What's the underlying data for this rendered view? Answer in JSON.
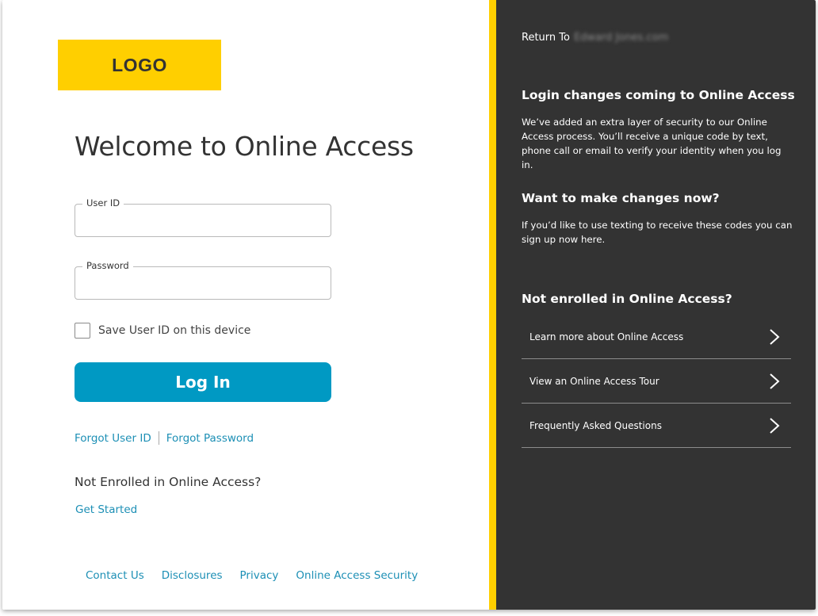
{
  "left": {
    "logo": "LOGO",
    "title": "Welcome to Online Access",
    "user_id_label": "User ID",
    "user_id_value": "",
    "password_label": "Password",
    "password_value": "",
    "save_user_label": "Save User ID on this device",
    "save_user_checked": false,
    "login_label": "Log In",
    "forgot_user": "Forgot User ID",
    "forgot_password": "Forgot Password",
    "not_enrolled": "Not Enrolled in Online Access?",
    "get_started": "Get Started",
    "footer": {
      "contact": "Contact Us",
      "disclosures": "Disclosures",
      "privacy": "Privacy",
      "security": "Online Access Security"
    }
  },
  "right": {
    "return_label": "Return To",
    "return_site": "Edward Jones.com",
    "section1": {
      "heading": "Login changes coming to Online Access",
      "text": "We’ve added an extra layer of security to our Online Access process. You’ll receive a unique code by text, phone call or email to verify your identity when you log in."
    },
    "section2": {
      "heading": "Want to make changes now?",
      "text": "If you’d like to use texting to receive these codes you can sign up now here."
    },
    "section3": {
      "heading": "Not enrolled in Online Access?"
    },
    "menu": [
      {
        "label": "Learn more about Online Access"
      },
      {
        "label": "View an Online Access Tour"
      },
      {
        "label": "Frequently Asked Questions"
      }
    ]
  },
  "colors": {
    "accent_yellow": "#ffcf00",
    "button_blue": "#0099c3",
    "link_blue": "#1c8fb5",
    "panel_dark": "#333333"
  },
  "icons": {
    "menu_chevron": "chevron-right-icon",
    "checkbox": "checkbox-icon"
  }
}
